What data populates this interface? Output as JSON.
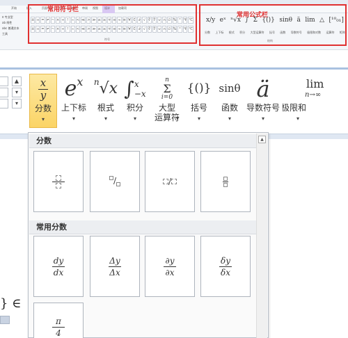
{
  "thumbnail": {
    "tabs": [
      "开始",
      "插入",
      "页面布局",
      "引用",
      "邮件",
      "审阅",
      "视图",
      "加载项",
      "设计"
    ],
    "symbols_label": "常用符号栏",
    "formulas_label": "常用公式栏",
    "symbols_group": "符号",
    "structures_group": "结构",
    "formula_icons": [
      "x/y",
      "eˣ",
      "ⁿ√x",
      "∫",
      "Σ",
      "{()}",
      "sinθ",
      "ä",
      "lim",
      "△",
      "[¹⁰₀₁]"
    ],
    "formula_labels": [
      "分数",
      "上下标",
      "根式",
      "积分",
      "大型运算符",
      "括号",
      "函数",
      "导数符号",
      "极限和对数",
      "运算符",
      "矩阵"
    ],
    "symbols": [
      "±",
      "∞",
      "=",
      "≠",
      "~",
      "×",
      "÷",
      "!",
      "∝",
      "<",
      "≪",
      ">",
      "≫",
      "≤",
      "≥",
      "∓",
      "≅",
      "≈",
      "≡",
      "∀",
      "∁",
      "∂",
      "√",
      "∛",
      "∜",
      "∪",
      "∩",
      "∅",
      "%",
      "°",
      "℉",
      "℃"
    ]
  },
  "toolbar": {
    "items": [
      {
        "id": "fraction",
        "label": "分数",
        "active": true
      },
      {
        "id": "script",
        "label": "上下标",
        "active": false
      },
      {
        "id": "radical",
        "label": "根式",
        "active": false
      },
      {
        "id": "integral",
        "label": "积分",
        "active": false
      },
      {
        "id": "large_operator",
        "label": "大型\n运算符",
        "active": false
      },
      {
        "id": "bracket",
        "label": "括号",
        "active": false
      },
      {
        "id": "function",
        "label": "函数",
        "active": false
      },
      {
        "id": "accent",
        "label": "导数符号",
        "active": false
      },
      {
        "id": "limit_log",
        "label": "极限和",
        "active": false
      }
    ],
    "icons": {
      "fraction_top": "x",
      "fraction_bottom": "y",
      "script": "e",
      "script_sup": "x",
      "radical_index": "n",
      "radical_body": "√x",
      "integral_sym": "∫",
      "integral_upper": "x",
      "integral_lower": "−x",
      "sum_upper": "n",
      "sum_sym": "Σ",
      "sum_lower": "i=0",
      "bracket": "{()}",
      "function": "sinθ",
      "accent": "ä",
      "limit": "lim",
      "limit_sub": "n→∞"
    }
  },
  "gallery": {
    "section1_title": "分数",
    "section2_title": "常用分数",
    "common_fractions": [
      {
        "num": "dy",
        "den": "dx"
      },
      {
        "num": "Δy",
        "den": "Δx"
      },
      {
        "num": "∂y",
        "den": "∂x"
      },
      {
        "num": "δy",
        "den": "δx"
      }
    ],
    "last_fraction": {
      "num": "π",
      "den": "4"
    }
  },
  "document": {
    "fragment_text": "} ∈"
  }
}
